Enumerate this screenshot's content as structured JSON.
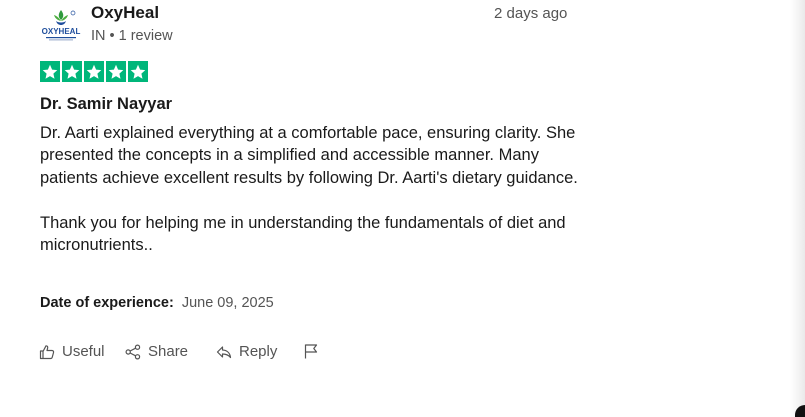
{
  "author": {
    "name": "OxyHeal",
    "logo_text": "OXYHEAL",
    "meta": "IN • 1 review",
    "time_ago": "2 days ago"
  },
  "rating": {
    "stars": 5,
    "max": 5,
    "color": "#00b67a"
  },
  "review": {
    "title": "Dr. Samir Nayyar",
    "paragraphs": [
      "Dr. Aarti explained everything at a comfortable pace, ensuring clarity. She presented the concepts in a simplified and accessible manner. Many patients achieve excellent results by following Dr. Aarti's dietary guidance.",
      "Thank you for helping me in understanding the fundamentals of diet and micronutrients.."
    ]
  },
  "experience": {
    "label": "Date of experience:",
    "date": "June 09, 2025"
  },
  "actions": {
    "useful": "Useful",
    "share": "Share",
    "reply": "Reply",
    "flag_icon": "flag-icon"
  }
}
